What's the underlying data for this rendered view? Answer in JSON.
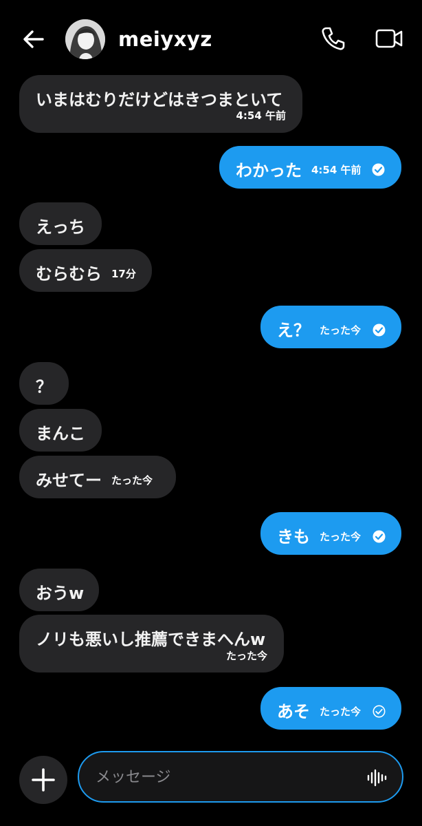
{
  "header": {
    "username": "meiyxyz"
  },
  "messages": [
    {
      "text": "いまはむりだけどはきつまといて",
      "time": "4:54 午前"
    },
    {
      "text": "わかった",
      "time": "4:54 午前"
    },
    {
      "text": "えっち"
    },
    {
      "text": "むらむら",
      "time": "17分"
    },
    {
      "text": "え？",
      "time": "たった今"
    },
    {
      "text": "？"
    },
    {
      "text": "まんこ"
    },
    {
      "text": "みせてー",
      "time": "たった今"
    },
    {
      "text": "きも",
      "time": "たった今"
    },
    {
      "text": "おうw"
    },
    {
      "text": "ノリも悪いし推薦できまへんw",
      "time": "たった今"
    },
    {
      "text": "あそ",
      "time": "たった今"
    }
  ],
  "composer": {
    "placeholder": "メッセージ"
  },
  "colors": {
    "background": "#000000",
    "incoming_bubble": "#262628",
    "outgoing_bubble": "#1d9bf0"
  },
  "icons": [
    "back-arrow-icon",
    "phone-icon",
    "video-camera-icon",
    "read-check-icon",
    "sent-check-icon",
    "plus-icon",
    "voice-wave-icon"
  ]
}
